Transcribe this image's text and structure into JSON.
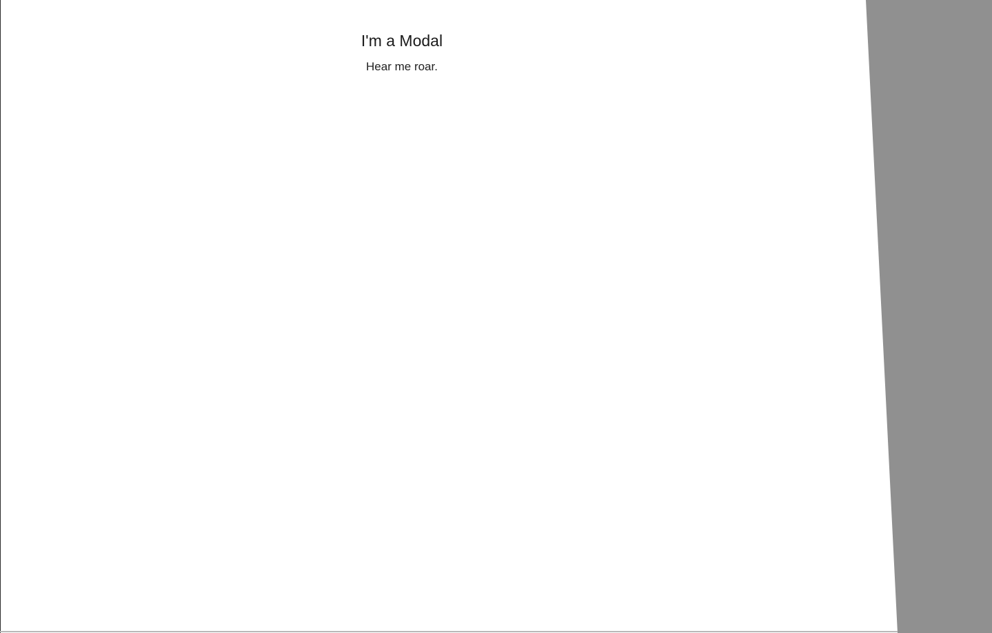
{
  "modal": {
    "title": "I'm a Modal",
    "body": "Hear me roar."
  },
  "colors": {
    "overlay": "#909090",
    "modal_background": "#ffffff",
    "title_text": "#1a1a1a",
    "body_text": "#222222"
  }
}
